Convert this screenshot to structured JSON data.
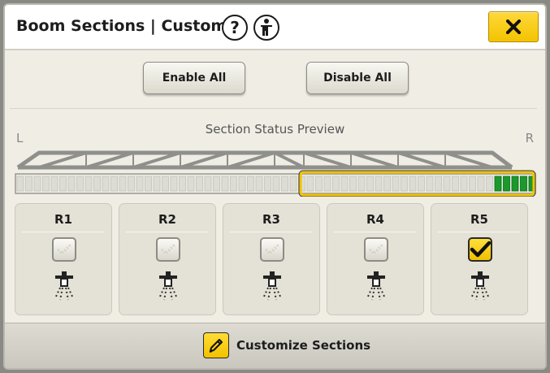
{
  "dialog": {
    "title": "Boom Sections | Custom",
    "help_icon_glyph": "?",
    "close_icon": "close-x-icon",
    "info_icon": "info-icon"
  },
  "actions": {
    "enable_all": "Enable All",
    "disable_all": "Disable All"
  },
  "preview": {
    "title": "Section Status Preview",
    "left_label": "L",
    "right_label": "R",
    "highlight_color": "#f2c200",
    "active_color": "#1a9a2a"
  },
  "sections": [
    {
      "label": "R1",
      "checked": false
    },
    {
      "label": "R2",
      "checked": false
    },
    {
      "label": "R3",
      "checked": false
    },
    {
      "label": "R4",
      "checked": false
    },
    {
      "label": "R5",
      "checked": true
    }
  ],
  "footer": {
    "customize_label": "Customize Sections",
    "customize_icon": "pencil-icon"
  }
}
